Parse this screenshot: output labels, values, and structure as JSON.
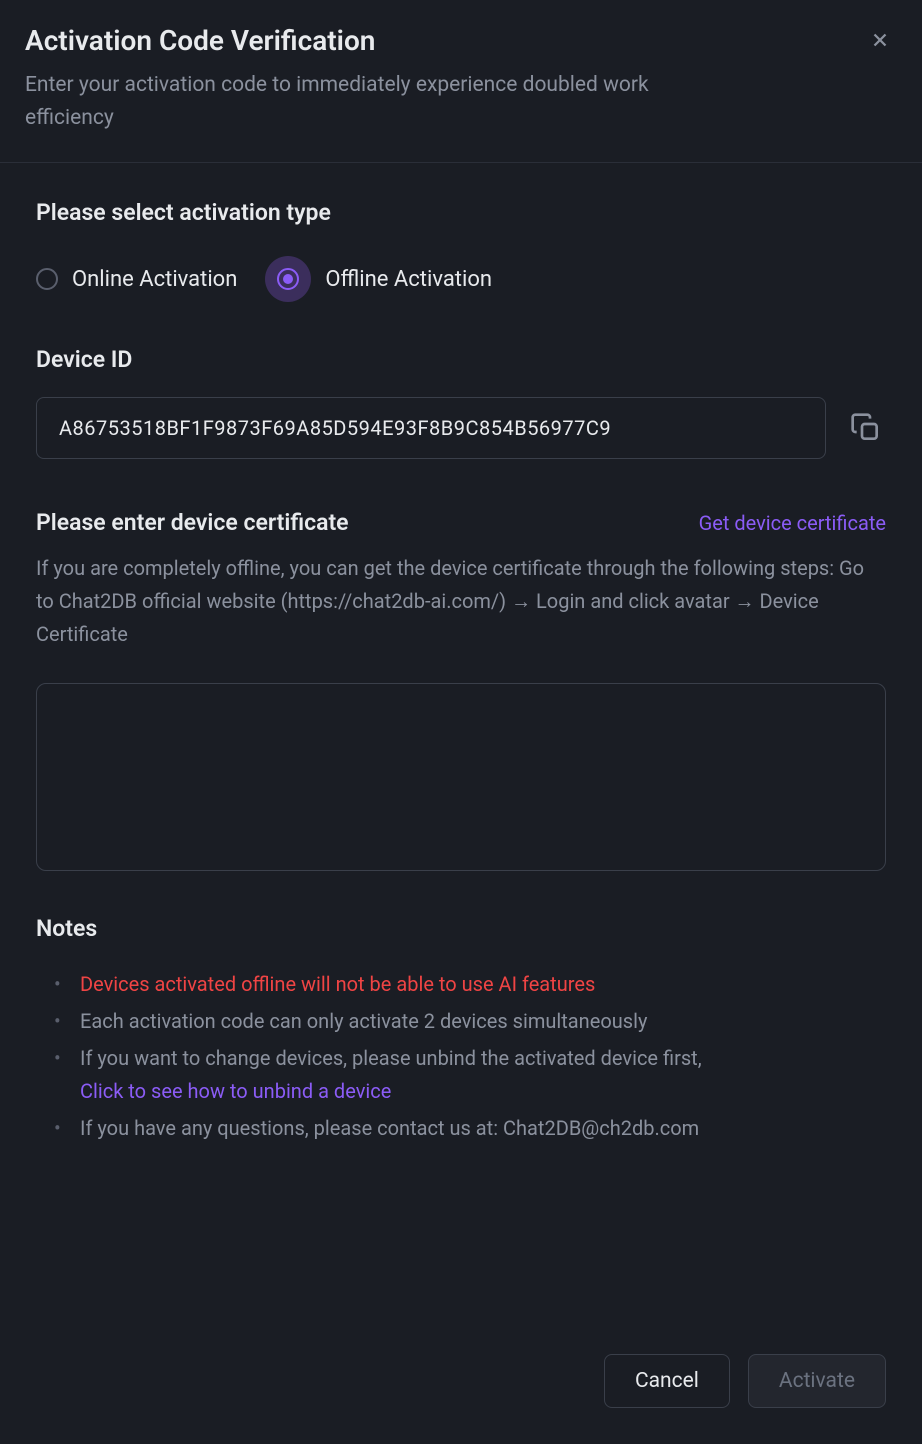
{
  "header": {
    "title": "Activation Code Verification",
    "subtitle": "Enter your activation code to immediately experience doubled work efficiency"
  },
  "activation_type": {
    "label": "Please select activation type",
    "options": {
      "online": "Online Activation",
      "offline": "Offline Activation"
    },
    "selected": "offline"
  },
  "device_id": {
    "label": "Device ID",
    "value": "A86753518BF1F9873F69A85D594E93F8B9C854B56977C9"
  },
  "certificate": {
    "label": "Please enter device certificate",
    "link_text": "Get device certificate",
    "help_text": "If you are completely offline, you can get the device certificate through the following steps: Go to Chat2DB official website (https://chat2db-ai.com/) → Login and click avatar → Device Certificate",
    "value": ""
  },
  "notes": {
    "label": "Notes",
    "items": [
      {
        "text": "Devices activated offline will not be able to use AI features",
        "type": "warning"
      },
      {
        "text": "Each activation code can only activate 2 devices simultaneously",
        "type": "normal"
      },
      {
        "text": "If you want to change devices, please unbind the activated device first,",
        "link_text": "Click to see how to unbind a device",
        "type": "normal_with_link"
      },
      {
        "text": "If you have any questions, please contact us at: Chat2DB@ch2db.com",
        "type": "normal"
      }
    ]
  },
  "footer": {
    "cancel": "Cancel",
    "activate": "Activate"
  }
}
